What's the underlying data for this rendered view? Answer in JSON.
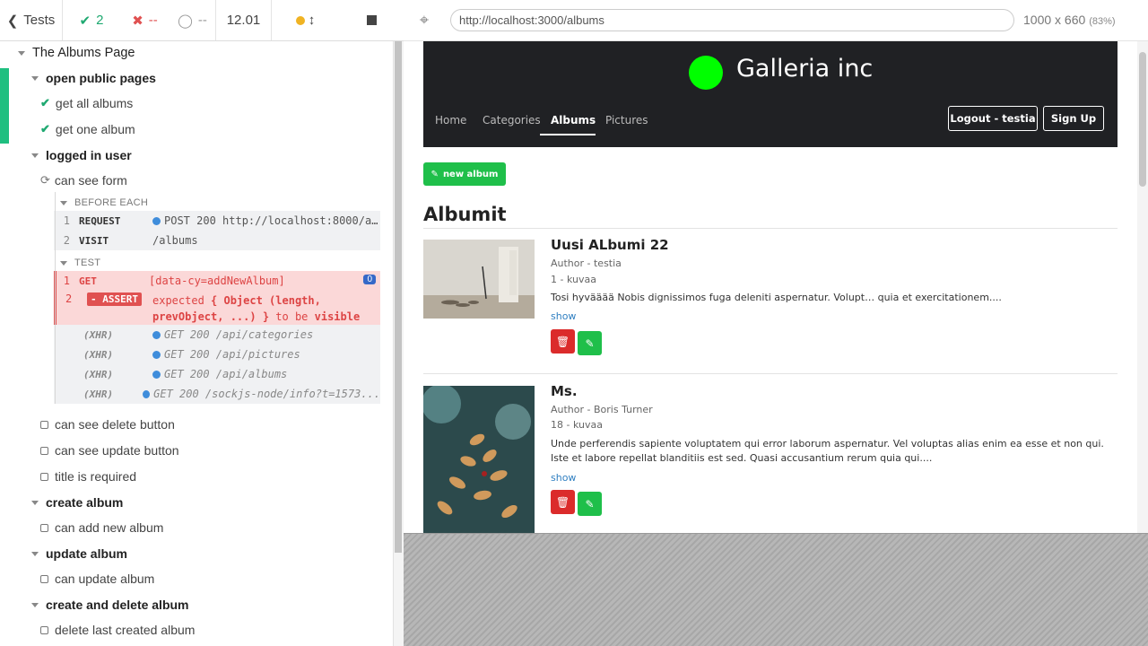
{
  "runner": {
    "back_label": "Tests",
    "passed": "2",
    "failed": "--",
    "pending": "--",
    "duration": "12.01",
    "root_suite": "The Albums Page",
    "suites": [
      {
        "title": "open public pages",
        "tests": [
          {
            "title": "get all albums",
            "state": "passed"
          },
          {
            "title": "get one album",
            "state": "passed"
          }
        ]
      },
      {
        "title": "logged in user",
        "tests": [
          {
            "title": "can see form",
            "state": "running"
          },
          {
            "title": "can see delete button",
            "state": "pending"
          },
          {
            "title": "can see update button",
            "state": "pending"
          },
          {
            "title": "title is required",
            "state": "pending"
          }
        ]
      },
      {
        "title": "create album",
        "tests": [
          {
            "title": "can add new album",
            "state": "pending"
          }
        ]
      },
      {
        "title": "update album",
        "tests": [
          {
            "title": "can update album",
            "state": "pending"
          }
        ]
      },
      {
        "title": "create and delete album",
        "tests": [
          {
            "title": "delete last created album",
            "state": "pending"
          }
        ]
      }
    ],
    "before_each_label": "BEFORE EACH",
    "test_label": "TEST",
    "before_each": [
      {
        "num": "1",
        "name": "REQUEST",
        "msg": "POST 200 http://localhost:8000/api/..."
      },
      {
        "num": "2",
        "name": "VISIT",
        "msg": "/albums"
      }
    ],
    "test_cmds": {
      "get": {
        "num": "1",
        "name": "GET",
        "msg": "[data-cy=addNewAlbum]",
        "badge": "0"
      },
      "assert": {
        "num": "2",
        "name": "- ASSERT",
        "pre": "expected ",
        "obj": "{ Object (length, prevObject, ...) }",
        "mid": " to be ",
        "end": "visible"
      }
    },
    "xhr": [
      {
        "label": "(XHR)",
        "msg": "GET 200 /api/categories"
      },
      {
        "label": "(XHR)",
        "msg": "GET 200 /api/pictures"
      },
      {
        "label": "(XHR)",
        "msg": "GET 200 /api/albums"
      },
      {
        "label": "(XHR)",
        "msg": "GET 200 /sockjs-node/info?t=1573..."
      }
    ]
  },
  "aut": {
    "url": "http://localhost:3000/albums",
    "viewport": "1000 x 660",
    "scale": "(83%)"
  },
  "site": {
    "title": "Galleria inc",
    "nav": [
      "Home",
      "Categories",
      "Albums",
      "Pictures"
    ],
    "logout": "Logout - testia",
    "signup": "Sign Up",
    "new_album": "new album",
    "heading": "Albumit",
    "albums": [
      {
        "title": "Uusi ALbumi 22",
        "author": "Author - testia",
        "count": "1 - kuvaa",
        "desc": "Tosi hyvääää Nobis dignissimos fuga deleniti aspernatur. Volupt… quia et exercitationem....",
        "show": "show"
      },
      {
        "title": "Ms.",
        "author": "Author - Boris Turner",
        "count": "18 - kuvaa",
        "desc": "Unde perferendis sapiente voluptatem qui error laborum aspernatur. Vel voluptas alias enim ea esse et non qui. Iste et labore repellat blanditiis est sed. Quasi accusantium rerum quia qui....",
        "show": "show"
      }
    ]
  },
  "colors": {
    "pass": "#1fa971",
    "fail": "#e05151",
    "accent_green": "#1fbf4a",
    "danger": "#db2b2b",
    "navbar": "#202124"
  }
}
